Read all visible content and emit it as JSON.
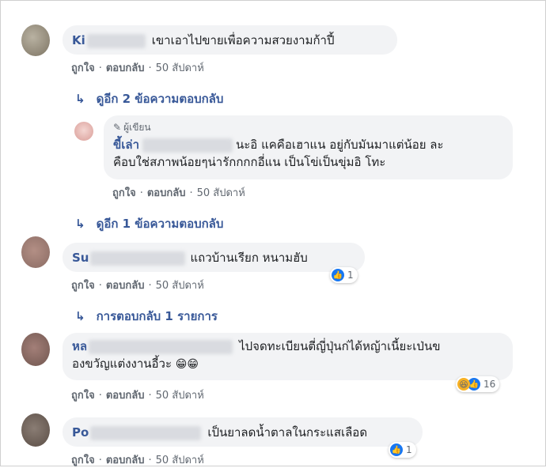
{
  "common": {
    "like": "ถูกใจ",
    "reply": "ตอบกลับ",
    "dot": "·",
    "time": "50 สัปดาห์"
  },
  "comments": [
    {
      "name_visible": "Ki",
      "text": "เขาเอาไปขายเพื่อความสวยงามก้าปี้"
    },
    {
      "author_tag": "ผู้เขียน",
      "name_visible": "ขี้เล่า",
      "text_line1": "นะอิ แคคือเฮาแน อยู่กับมันมาแต่น้อย ละ",
      "text_line2": "คือบใช่สภาพน้อยๆน่ารักกกกอี่แน เป็นโข่เป็นขุ่มอิ โทะ"
    },
    {
      "name_visible": "Su",
      "text": "แถวบ้านเรียก หนามฮับ",
      "reactions": "1"
    },
    {
      "name_visible": "หล",
      "text_line1": "ไปจดทะเบียนตี่ญี่ปุ่นก่ได้หญ้าเนี้ยะเป่นข",
      "text_line2": "องขวัญแต่งงานอี้วะ",
      "emoji": "😁😁",
      "reactions": "16"
    },
    {
      "name_visible": "Po",
      "text": "เป็นยาลดน้ำตาลในกระแสเลือด",
      "reactions": "1"
    }
  ],
  "more_replies": [
    {
      "arrow": "↳",
      "label": "ดูอีก 2 ข้อความตอบกลับ"
    },
    {
      "arrow": "↳",
      "label": "ดูอีก 1 ข้อความตอบกลับ"
    },
    {
      "arrow": "↳",
      "label": "การตอบกลับ 1 รายการ"
    }
  ],
  "icons": {
    "like": "like-icon",
    "haha": "haha-icon",
    "pencil": "pencil-icon",
    "reply_arrow": "reply-arrow-icon"
  },
  "colors": {
    "link": "#385898",
    "bubble": "#f2f3f5",
    "like_blue": "#1877f2"
  }
}
